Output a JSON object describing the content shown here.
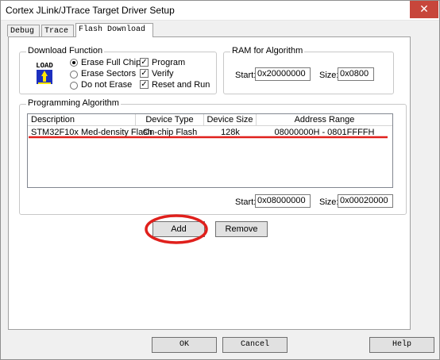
{
  "window": {
    "title": "Cortex JLink/JTrace Target Driver Setup",
    "close_symbol": "✕"
  },
  "tabs": [
    {
      "label": "Debug"
    },
    {
      "label": "Trace"
    },
    {
      "label": "Flash Download"
    }
  ],
  "download_function": {
    "legend": "Download Function",
    "icon_text": "LOAD",
    "erase_options": [
      {
        "label": "Erase Full Chip",
        "selected": true
      },
      {
        "label": "Erase Sectors",
        "selected": false
      },
      {
        "label": "Do not Erase",
        "selected": false
      }
    ],
    "checks": [
      {
        "label": "Program",
        "checked": true
      },
      {
        "label": "Verify",
        "checked": true
      },
      {
        "label": "Reset and Run",
        "checked": true
      }
    ]
  },
  "ram": {
    "legend": "RAM for Algorithm",
    "start_label": "Start:",
    "start_value": "0x20000000",
    "size_label": "Size:",
    "size_value": "0x0800"
  },
  "programming": {
    "legend": "Programming Algorithm",
    "headers": [
      "Description",
      "Device Type",
      "Device Size",
      "Address Range"
    ],
    "rows": [
      [
        "STM32F10x Med-density Flash",
        "On-chip Flash",
        "128k",
        "08000000H - 0801FFFFH"
      ]
    ],
    "start_label": "Start:",
    "start_value": "0x08000000",
    "size_label": "Size:",
    "size_value": "0x00020000",
    "add_label": "Add",
    "remove_label": "Remove"
  },
  "footer": {
    "ok_label": "OK",
    "cancel_label": "Cancel",
    "help_label": "Help"
  },
  "colors": {
    "annotation": "#e0201c",
    "close": "#c7463b",
    "check": "✓"
  }
}
